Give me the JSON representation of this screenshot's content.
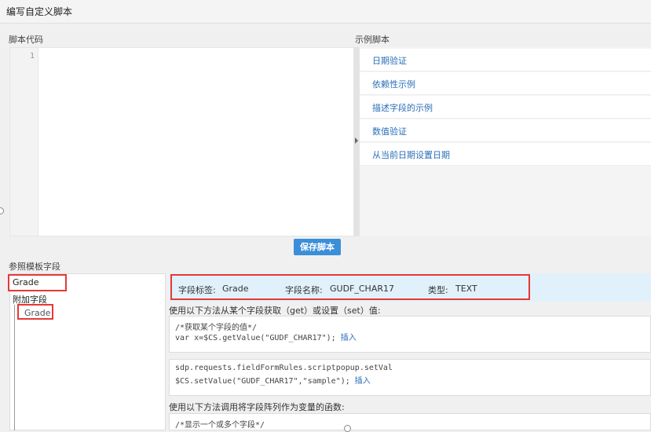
{
  "title": "编写自定义脚本",
  "script_code_label": "脚本代码",
  "sample_scripts_label": "示例脚本",
  "editor": {
    "line_number": "1"
  },
  "samples": [
    "日期验证",
    "依赖性示例",
    "描述字段的示例",
    "数值验证",
    "从当前日期设置日期"
  ],
  "save_button": "保存脚本",
  "reference_label": "参照模板字段",
  "search": {
    "value": "Grade"
  },
  "tree": {
    "root": "附加字段",
    "child": "Grade"
  },
  "field_info": {
    "label_key": "字段标签:",
    "label_val": "Grade",
    "name_key": "字段名称:",
    "name_val": "GUDF_CHAR17",
    "type_key": "类型:",
    "type_val": "TEXT"
  },
  "get_set_desc": "使用以下方法从某个字段获取（get）或设置（set）值:",
  "code1": {
    "line1": "/*获取某个字段的值*/",
    "line2": "var x=$CS.getValue(\"GUDF_CHAR17\");",
    "insert": "插入"
  },
  "code2": {
    "line1": "sdp.requests.fieldFormRules.scriptpopup.setVal",
    "line2": "$CS.setValue(\"GUDF_CHAR17\",\"sample\");",
    "insert": "插入"
  },
  "array_desc": "使用以下方法调用将字段阵列作为变量的函数:",
  "code3": {
    "line1": "/*显示一个或多个字段*/"
  }
}
